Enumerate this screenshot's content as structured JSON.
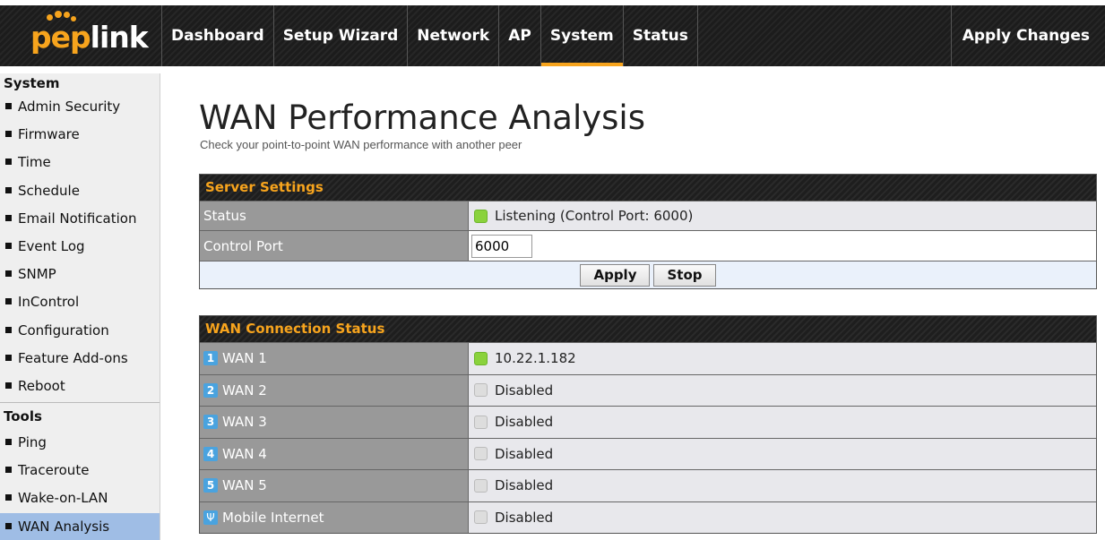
{
  "brand": {
    "logo_prefix": "pep",
    "logo_suffix": "link",
    "accent": "#f7a41d"
  },
  "nav": {
    "items": [
      {
        "label": "Dashboard",
        "active": false
      },
      {
        "label": "Setup Wizard",
        "active": false
      },
      {
        "label": "Network",
        "active": false
      },
      {
        "label": "AP",
        "active": false
      },
      {
        "label": "System",
        "active": true
      },
      {
        "label": "Status",
        "active": false
      }
    ],
    "apply_changes": "Apply Changes"
  },
  "sidebar": {
    "system_header": "System",
    "system_items": [
      "Admin Security",
      "Firmware",
      "Time",
      "Schedule",
      "Email Notification",
      "Event Log",
      "SNMP",
      "InControl",
      "Configuration",
      "Feature Add-ons",
      "Reboot"
    ],
    "tools_header": "Tools",
    "tools_items": [
      "Ping",
      "Traceroute",
      "Wake-on-LAN",
      "WAN Analysis"
    ],
    "active_item": "WAN Analysis"
  },
  "page": {
    "title": "WAN Performance Analysis",
    "subtitle": "Check your point-to-point WAN performance with another peer"
  },
  "server_settings": {
    "header": "Server Settings",
    "status_label": "Status",
    "status_value": "Listening (Control Port: 6000)",
    "status_color": "#8ad23c",
    "port_label": "Control Port",
    "port_value": "6000",
    "apply_button": "Apply",
    "stop_button": "Stop"
  },
  "wan_status": {
    "header": "WAN Connection Status",
    "rows": [
      {
        "badge": "1",
        "label": "WAN 1",
        "value": "10.22.1.182",
        "state": "green"
      },
      {
        "badge": "2",
        "label": "WAN 2",
        "value": "Disabled",
        "state": "gray"
      },
      {
        "badge": "3",
        "label": "WAN 3",
        "value": "Disabled",
        "state": "gray"
      },
      {
        "badge": "4",
        "label": "WAN 4",
        "value": "Disabled",
        "state": "gray"
      },
      {
        "badge": "5",
        "label": "WAN 5",
        "value": "Disabled",
        "state": "gray"
      },
      {
        "badge": "usb",
        "label": "Mobile Internet",
        "value": "Disabled",
        "state": "gray"
      }
    ]
  }
}
